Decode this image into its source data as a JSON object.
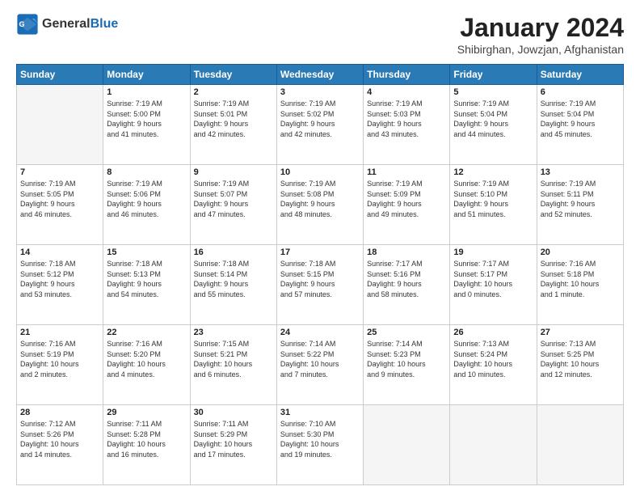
{
  "header": {
    "logo_line1": "General",
    "logo_line2": "Blue",
    "month_year": "January 2024",
    "location": "Shibirghan, Jowzjan, Afghanistan"
  },
  "days_of_week": [
    "Sunday",
    "Monday",
    "Tuesday",
    "Wednesday",
    "Thursday",
    "Friday",
    "Saturday"
  ],
  "weeks": [
    [
      {
        "day": "",
        "info": ""
      },
      {
        "day": "1",
        "info": "Sunrise: 7:19 AM\nSunset: 5:00 PM\nDaylight: 9 hours\nand 41 minutes."
      },
      {
        "day": "2",
        "info": "Sunrise: 7:19 AM\nSunset: 5:01 PM\nDaylight: 9 hours\nand 42 minutes."
      },
      {
        "day": "3",
        "info": "Sunrise: 7:19 AM\nSunset: 5:02 PM\nDaylight: 9 hours\nand 42 minutes."
      },
      {
        "day": "4",
        "info": "Sunrise: 7:19 AM\nSunset: 5:03 PM\nDaylight: 9 hours\nand 43 minutes."
      },
      {
        "day": "5",
        "info": "Sunrise: 7:19 AM\nSunset: 5:04 PM\nDaylight: 9 hours\nand 44 minutes."
      },
      {
        "day": "6",
        "info": "Sunrise: 7:19 AM\nSunset: 5:04 PM\nDaylight: 9 hours\nand 45 minutes."
      }
    ],
    [
      {
        "day": "7",
        "info": "Sunrise: 7:19 AM\nSunset: 5:05 PM\nDaylight: 9 hours\nand 46 minutes."
      },
      {
        "day": "8",
        "info": "Sunrise: 7:19 AM\nSunset: 5:06 PM\nDaylight: 9 hours\nand 46 minutes."
      },
      {
        "day": "9",
        "info": "Sunrise: 7:19 AM\nSunset: 5:07 PM\nDaylight: 9 hours\nand 47 minutes."
      },
      {
        "day": "10",
        "info": "Sunrise: 7:19 AM\nSunset: 5:08 PM\nDaylight: 9 hours\nand 48 minutes."
      },
      {
        "day": "11",
        "info": "Sunrise: 7:19 AM\nSunset: 5:09 PM\nDaylight: 9 hours\nand 49 minutes."
      },
      {
        "day": "12",
        "info": "Sunrise: 7:19 AM\nSunset: 5:10 PM\nDaylight: 9 hours\nand 51 minutes."
      },
      {
        "day": "13",
        "info": "Sunrise: 7:19 AM\nSunset: 5:11 PM\nDaylight: 9 hours\nand 52 minutes."
      }
    ],
    [
      {
        "day": "14",
        "info": "Sunrise: 7:18 AM\nSunset: 5:12 PM\nDaylight: 9 hours\nand 53 minutes."
      },
      {
        "day": "15",
        "info": "Sunrise: 7:18 AM\nSunset: 5:13 PM\nDaylight: 9 hours\nand 54 minutes."
      },
      {
        "day": "16",
        "info": "Sunrise: 7:18 AM\nSunset: 5:14 PM\nDaylight: 9 hours\nand 55 minutes."
      },
      {
        "day": "17",
        "info": "Sunrise: 7:18 AM\nSunset: 5:15 PM\nDaylight: 9 hours\nand 57 minutes."
      },
      {
        "day": "18",
        "info": "Sunrise: 7:17 AM\nSunset: 5:16 PM\nDaylight: 9 hours\nand 58 minutes."
      },
      {
        "day": "19",
        "info": "Sunrise: 7:17 AM\nSunset: 5:17 PM\nDaylight: 10 hours\nand 0 minutes."
      },
      {
        "day": "20",
        "info": "Sunrise: 7:16 AM\nSunset: 5:18 PM\nDaylight: 10 hours\nand 1 minute."
      }
    ],
    [
      {
        "day": "21",
        "info": "Sunrise: 7:16 AM\nSunset: 5:19 PM\nDaylight: 10 hours\nand 2 minutes."
      },
      {
        "day": "22",
        "info": "Sunrise: 7:16 AM\nSunset: 5:20 PM\nDaylight: 10 hours\nand 4 minutes."
      },
      {
        "day": "23",
        "info": "Sunrise: 7:15 AM\nSunset: 5:21 PM\nDaylight: 10 hours\nand 6 minutes."
      },
      {
        "day": "24",
        "info": "Sunrise: 7:14 AM\nSunset: 5:22 PM\nDaylight: 10 hours\nand 7 minutes."
      },
      {
        "day": "25",
        "info": "Sunrise: 7:14 AM\nSunset: 5:23 PM\nDaylight: 10 hours\nand 9 minutes."
      },
      {
        "day": "26",
        "info": "Sunrise: 7:13 AM\nSunset: 5:24 PM\nDaylight: 10 hours\nand 10 minutes."
      },
      {
        "day": "27",
        "info": "Sunrise: 7:13 AM\nSunset: 5:25 PM\nDaylight: 10 hours\nand 12 minutes."
      }
    ],
    [
      {
        "day": "28",
        "info": "Sunrise: 7:12 AM\nSunset: 5:26 PM\nDaylight: 10 hours\nand 14 minutes."
      },
      {
        "day": "29",
        "info": "Sunrise: 7:11 AM\nSunset: 5:28 PM\nDaylight: 10 hours\nand 16 minutes."
      },
      {
        "day": "30",
        "info": "Sunrise: 7:11 AM\nSunset: 5:29 PM\nDaylight: 10 hours\nand 17 minutes."
      },
      {
        "day": "31",
        "info": "Sunrise: 7:10 AM\nSunset: 5:30 PM\nDaylight: 10 hours\nand 19 minutes."
      },
      {
        "day": "",
        "info": ""
      },
      {
        "day": "",
        "info": ""
      },
      {
        "day": "",
        "info": ""
      }
    ]
  ]
}
